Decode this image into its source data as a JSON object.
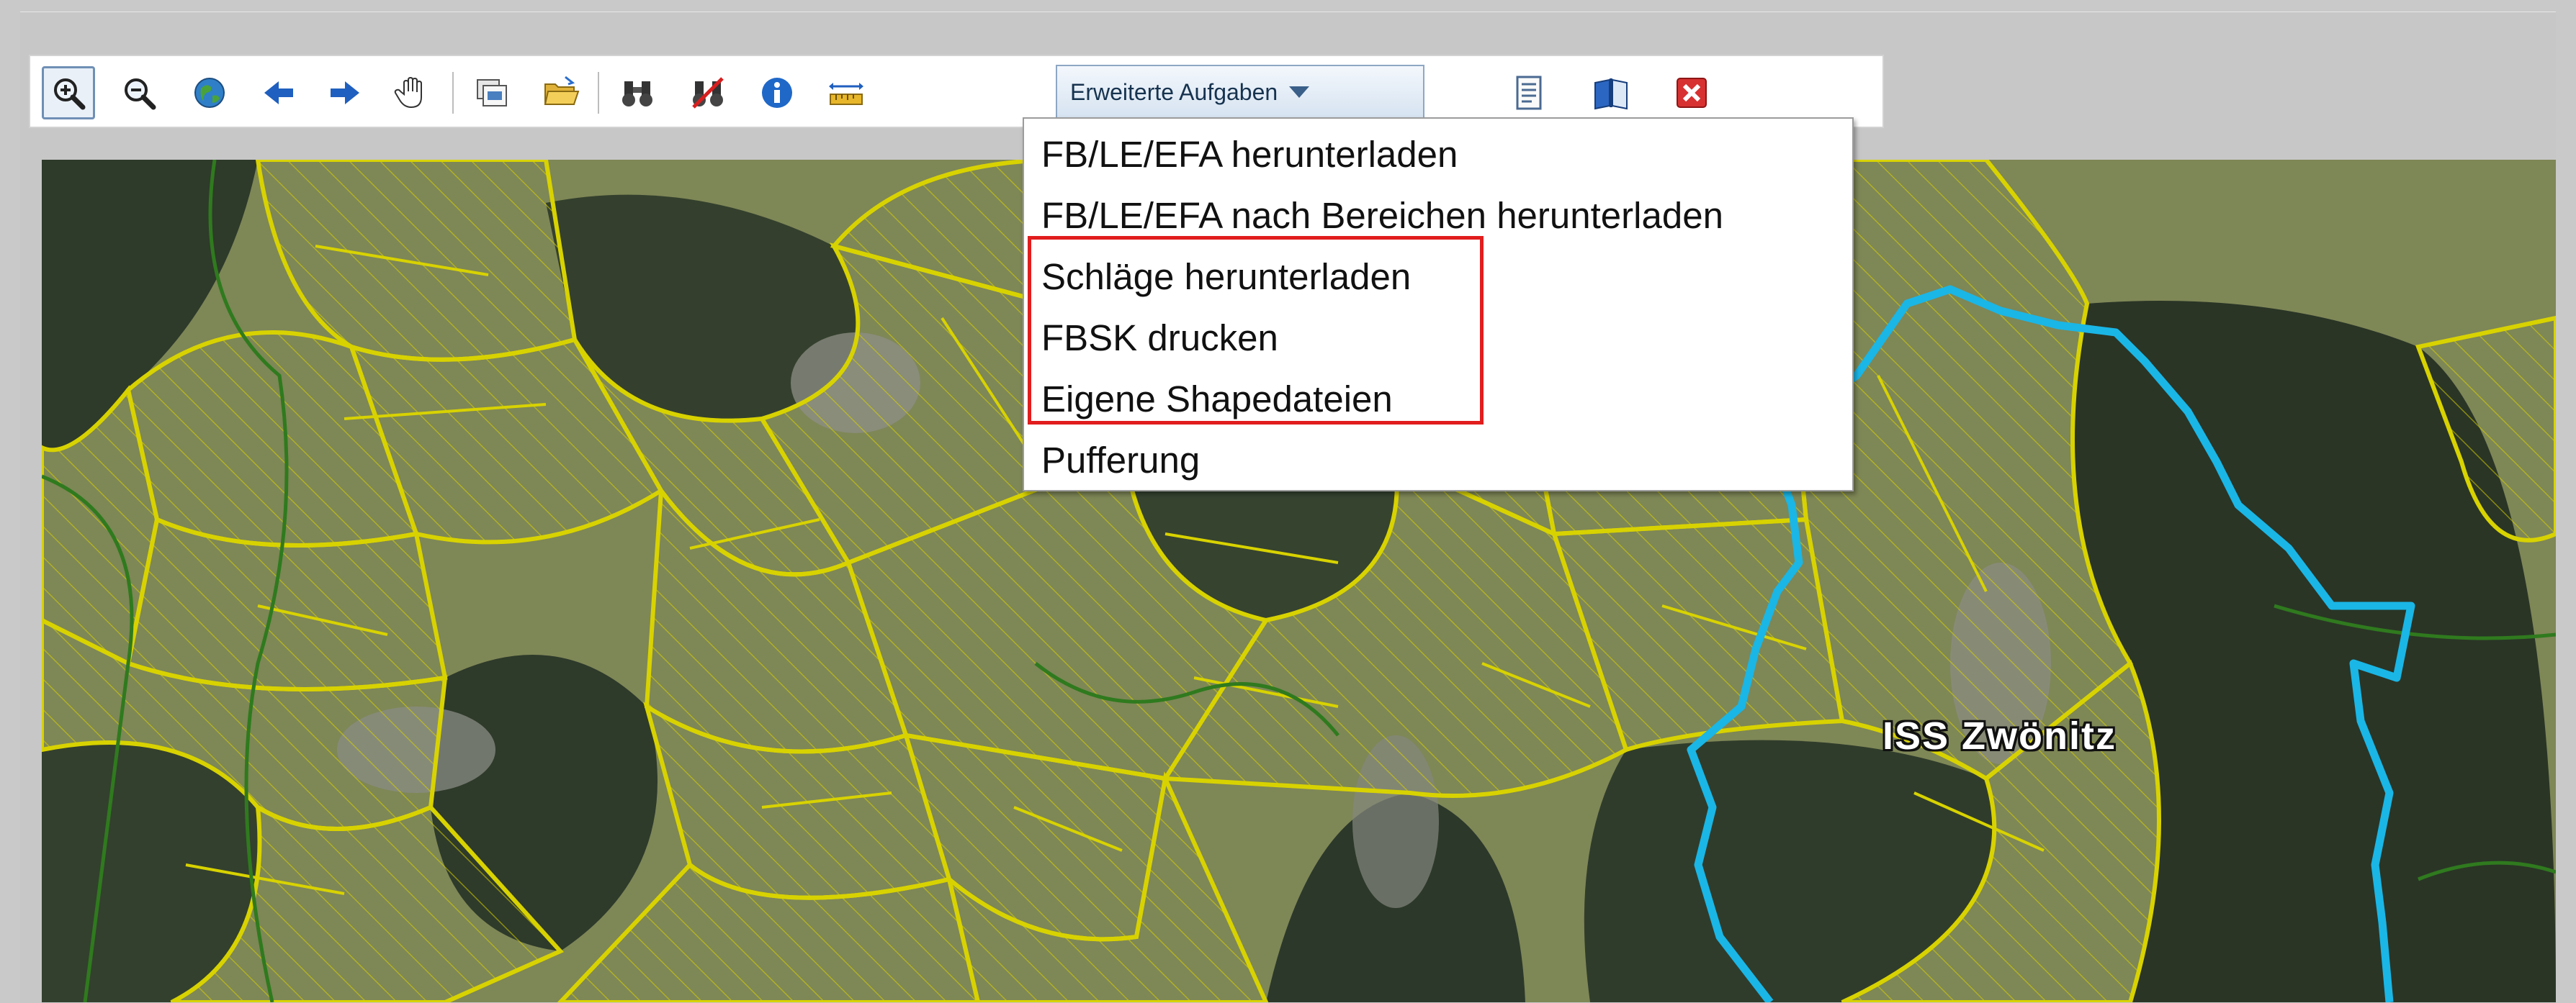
{
  "toolbar": {
    "tools": [
      {
        "name": "zoom-in-icon",
        "active": true
      },
      {
        "name": "zoom-out-icon"
      },
      {
        "name": "globe-icon"
      },
      {
        "name": "arrow-left-icon"
      },
      {
        "name": "arrow-right-icon"
      },
      {
        "name": "pan-hand-icon"
      },
      {
        "name": "layers-save-icon"
      },
      {
        "name": "open-folder-icon"
      },
      {
        "name": "binoculars-icon"
      },
      {
        "name": "binoculars-clear-icon"
      },
      {
        "name": "info-icon"
      },
      {
        "name": "measure-ruler-icon"
      },
      {
        "name": "document-icon"
      },
      {
        "name": "book-icon"
      },
      {
        "name": "close-icon"
      }
    ],
    "dropdown_label": "Erweiterte Aufgaben"
  },
  "menu": {
    "items": [
      "FB/LE/EFA herunterladen",
      "FB/LE/EFA nach Bereichen herunterladen",
      "Schläge herunterladen",
      "FBSK drucken",
      "Eigene Shapedateien",
      "Pufferung"
    ],
    "highlighted_items": [
      "Schläge herunterladen",
      "FBSK drucken",
      "Eigene Shapedateien"
    ]
  },
  "map": {
    "label": "ISS Zwönitz",
    "colors": {
      "parcel_outline": "#d8d200",
      "boundary": "#1ab6e6",
      "green_lines": "#2f7a1e",
      "forest": "#2e3a2a",
      "field": "#8f9660"
    }
  },
  "colors": {
    "highlight": "#e11d1d",
    "toolbar_bg": "#ffffff",
    "frame_bg": "#c7c7c7"
  }
}
